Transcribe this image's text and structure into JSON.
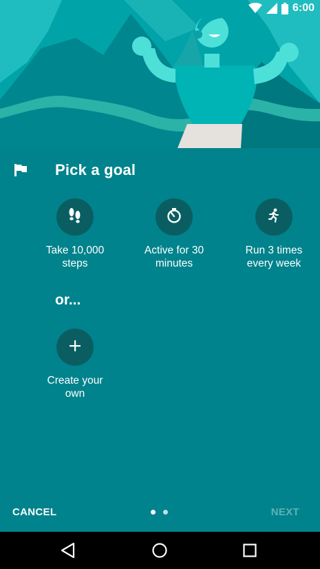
{
  "status_bar": {
    "time": "6:00",
    "icons": [
      "wifi-icon",
      "signal-icon",
      "battery-icon"
    ]
  },
  "header": {
    "icon": "flag-icon",
    "title": "Pick a goal"
  },
  "goals": [
    {
      "icon": "footsteps-icon",
      "label_line1": "Take 10,000",
      "label_line2": "steps"
    },
    {
      "icon": "timer-icon",
      "label_line1": "Active for 30",
      "label_line2": "minutes"
    },
    {
      "icon": "running-icon",
      "label_line1": "Run 3 times",
      "label_line2": "every week"
    }
  ],
  "or_text": "or...",
  "custom_goal": {
    "icon": "plus-icon",
    "label_line1": "Create your",
    "label_line2": "own"
  },
  "footer": {
    "cancel_label": "CANCEL",
    "next_label": "NEXT",
    "page_indicator": {
      "pages": 2,
      "current": 1
    }
  },
  "nav_bar": {
    "icons": [
      "back-icon",
      "home-icon",
      "recents-icon"
    ]
  },
  "colors": {
    "background": "#00838c",
    "icon_circle": "#0a5e61",
    "hero_light": "#26c6c6",
    "disabled_text": "#5fb1b6"
  }
}
